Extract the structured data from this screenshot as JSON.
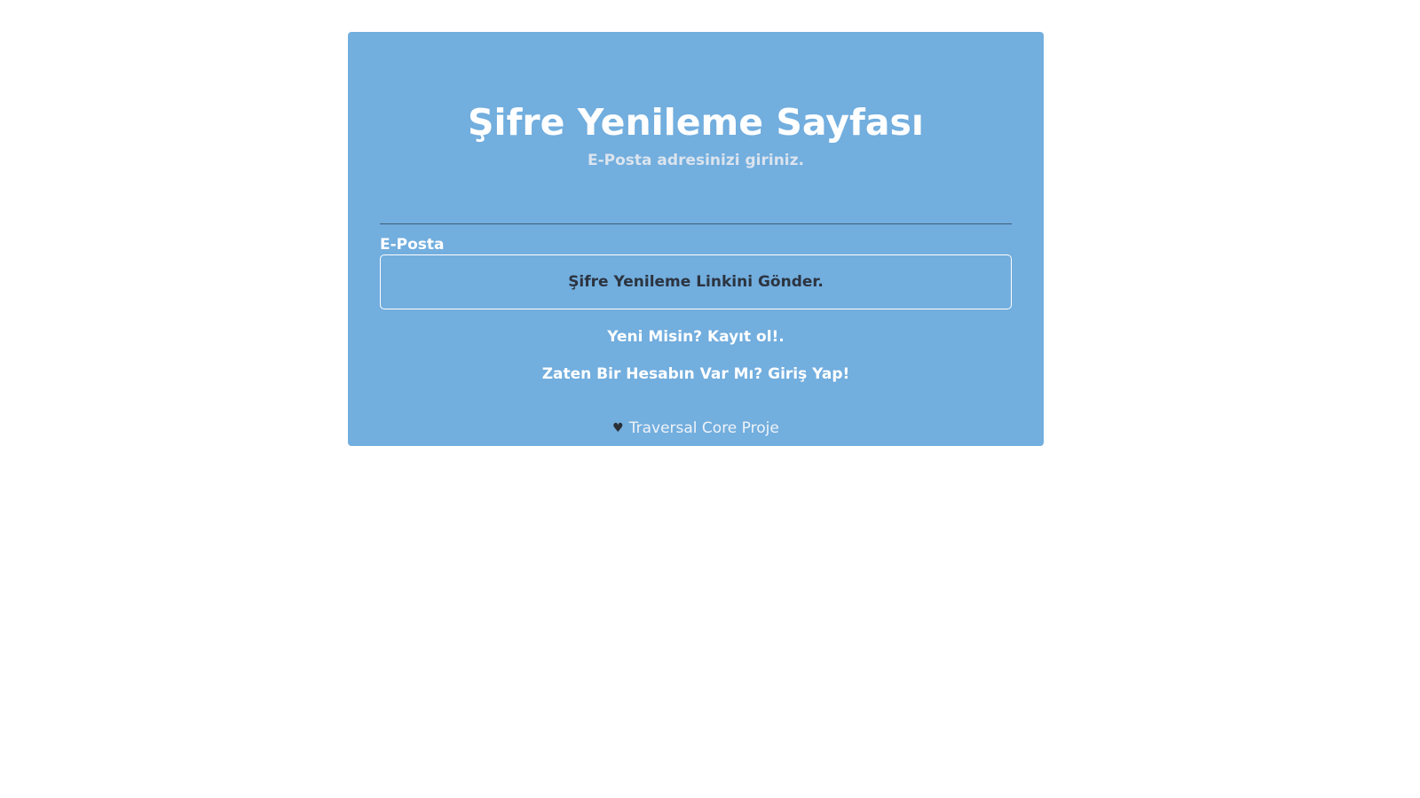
{
  "page": {
    "title": "Şifre Yenileme Sayfası",
    "subtitle": "E-Posta adresinizi giriniz."
  },
  "form": {
    "email_label": "E-Posta",
    "email_value": "",
    "submit_label": "Şifre Yenileme Linkini Gönder."
  },
  "links": {
    "register": "Yeni Misin? Kayıt ol!.",
    "login": "Zaten Bir Hesabın Var Mı? Giriş Yap!"
  },
  "footer": {
    "icon": "heart-icon",
    "text": "Traversal Core Proje"
  },
  "colors": {
    "card_background": "#72aede",
    "page_background": "#ffffff"
  }
}
